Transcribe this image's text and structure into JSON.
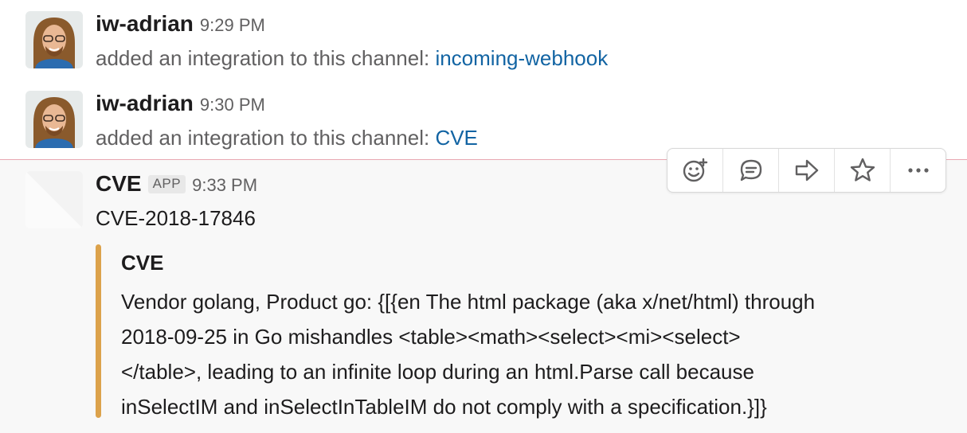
{
  "messages": [
    {
      "author": "iw-adrian",
      "time": "9:29 PM",
      "text": "added an integration to this channel: ",
      "link": "incoming-webhook"
    },
    {
      "author": "iw-adrian",
      "time": "9:30 PM",
      "text": "added an integration to this channel: ",
      "link": "CVE"
    }
  ],
  "cve_message": {
    "author": "CVE",
    "badge": "APP",
    "time": "9:33 PM",
    "text": "CVE-2018-17846",
    "attachment": {
      "title": "CVE",
      "lines": [
        "Vendor golang, Product go: {[{en The html package (aka x/net/html) through",
        "2018-09-25 in Go mishandles <table><math><select><mi><select>",
        "</table>, leading to an infinite loop during an html.Parse call because",
        "inSelectIM and inSelectInTableIM do not comply with a specification.}]}"
      ],
      "accent_color": "#dca24b"
    }
  },
  "toolbar": {
    "actions": [
      "add-reaction-icon",
      "start-thread-icon",
      "share-message-icon",
      "star-icon",
      "more-actions-icon"
    ]
  },
  "colors": {
    "link": "#1264a3",
    "divider": "#e8a8b2",
    "muted": "#616061"
  }
}
